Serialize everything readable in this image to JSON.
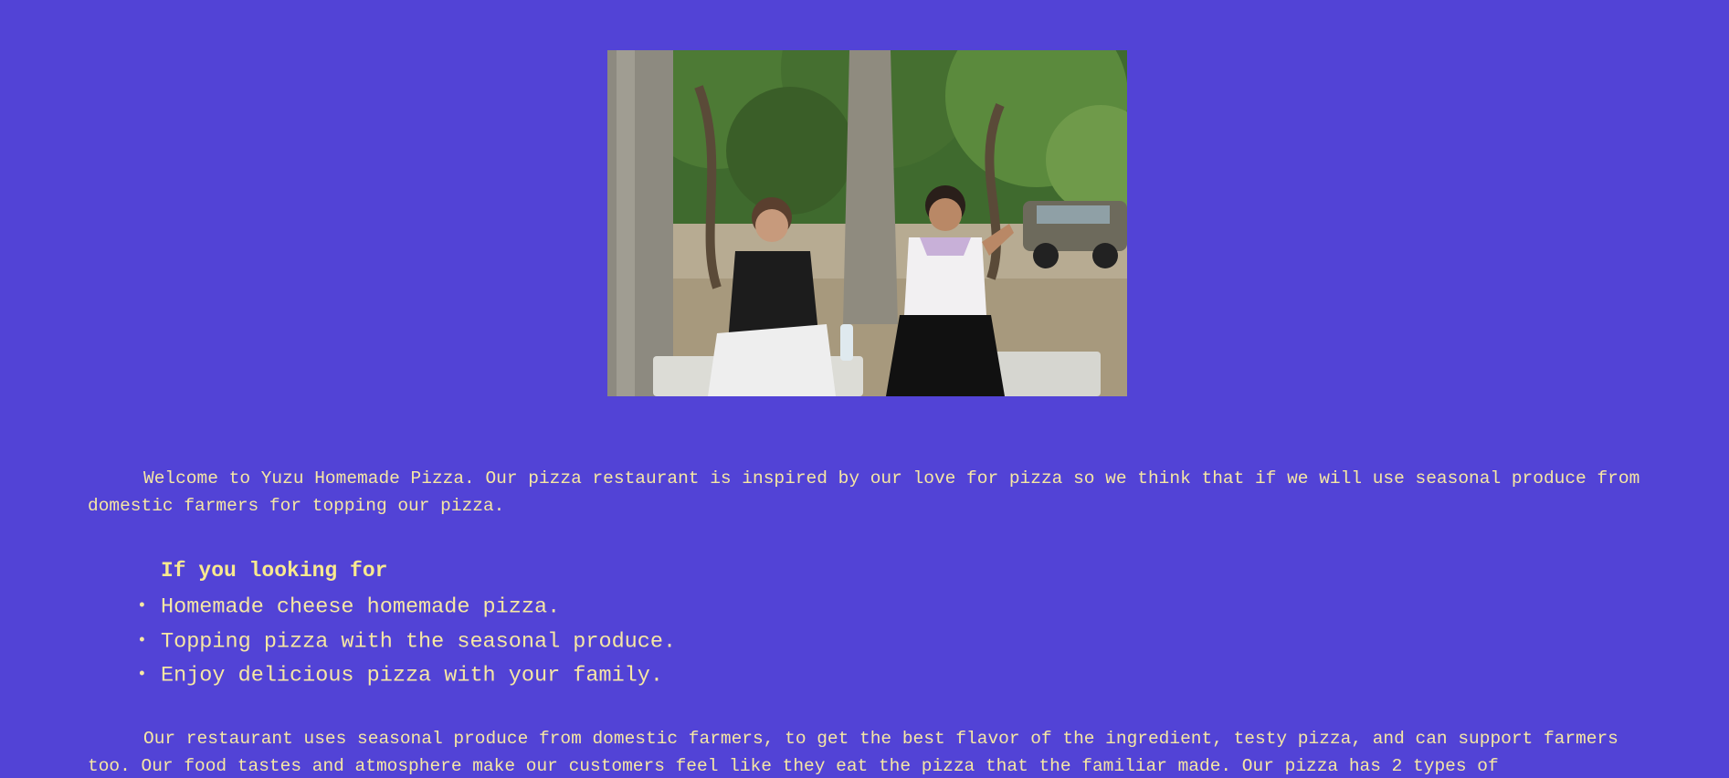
{
  "hero": {
    "image_subject": "two students sitting on a bench under trees in a park"
  },
  "intro_paragraph": "Welcome to Yuzu Homemade Pizza. Our pizza restaurant is inspired by our love for pizza so we think that if we will use seasonal produce from domestic farmers for topping our pizza.",
  "looking_for": {
    "title": "If you looking for",
    "items": [
      "Homemade cheese homemade pizza.",
      "Topping pizza with the seasonal produce.",
      "Enjoy delicious pizza with your family."
    ]
  },
  "story_paragraph": "Our restaurant uses seasonal produce from domestic farmers, to get the best flavor of the ingredient, testy pizza, and can support farmers too. Our food tastes and atmosphere make our customers feel like they eat the pizza that the familiar made. Our pizza has 2 types of",
  "colors": {
    "background": "#5243d6",
    "text": "#f6e7a4"
  }
}
